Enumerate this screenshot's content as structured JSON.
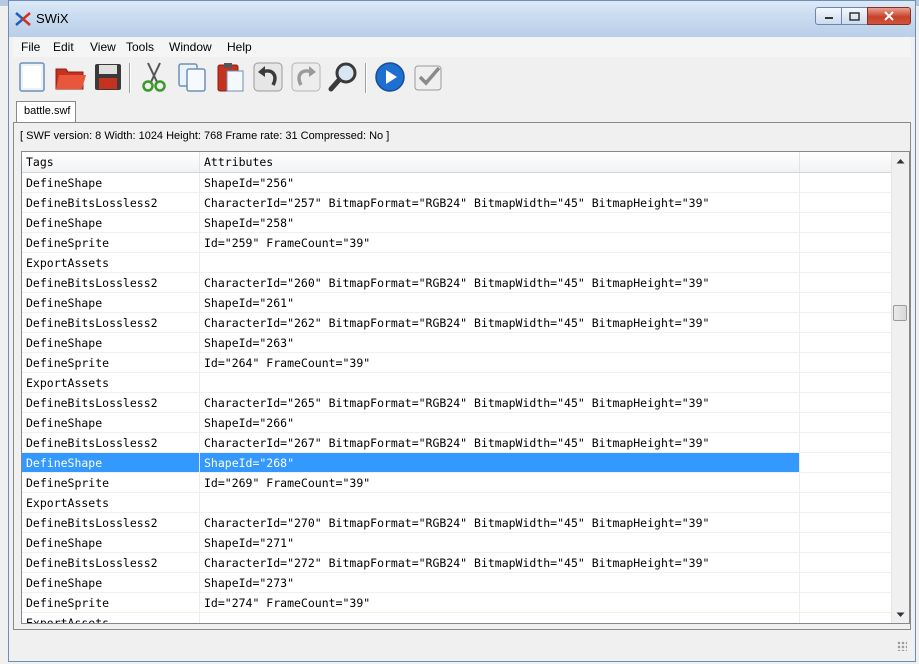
{
  "window": {
    "title": "SWiX"
  },
  "menu": {
    "items": [
      "File",
      "Edit",
      "View",
      "Tools",
      "Window",
      "Help"
    ]
  },
  "toolbar": {
    "buttons": [
      {
        "icon": "new-document-icon"
      },
      {
        "icon": "open-folder-icon"
      },
      {
        "icon": "save-disk-icon"
      },
      {
        "icon": "cut-scissors-icon"
      },
      {
        "icon": "copy-icon"
      },
      {
        "icon": "paste-clipboard-icon"
      },
      {
        "icon": "undo-arrow-icon"
      },
      {
        "icon": "redo-arrow-icon"
      },
      {
        "icon": "find-magnifier-icon"
      },
      {
        "icon": "run-play-icon"
      },
      {
        "icon": "validate-check-icon"
      }
    ]
  },
  "tabs": [
    {
      "label": "battle.swf"
    }
  ],
  "info": {
    "text": "[ SWF version: 8  Width: 1024  Height: 768  Frame rate: 31  Compressed: No ]"
  },
  "table": {
    "columns": [
      "Tags",
      "Attributes"
    ],
    "selected_index": 14,
    "rows": [
      {
        "tag": "DefineShape",
        "attributes": "ShapeId=\"256\""
      },
      {
        "tag": "DefineBitsLossless2",
        "attributes": "CharacterId=\"257\" BitmapFormat=\"RGB24\" BitmapWidth=\"45\" BitmapHeight=\"39\""
      },
      {
        "tag": "DefineShape",
        "attributes": "ShapeId=\"258\""
      },
      {
        "tag": "DefineSprite",
        "attributes": "Id=\"259\" FrameCount=\"39\""
      },
      {
        "tag": "ExportAssets",
        "attributes": ""
      },
      {
        "tag": "DefineBitsLossless2",
        "attributes": "CharacterId=\"260\" BitmapFormat=\"RGB24\" BitmapWidth=\"45\" BitmapHeight=\"39\""
      },
      {
        "tag": "DefineShape",
        "attributes": "ShapeId=\"261\""
      },
      {
        "tag": "DefineBitsLossless2",
        "attributes": "CharacterId=\"262\" BitmapFormat=\"RGB24\" BitmapWidth=\"45\" BitmapHeight=\"39\""
      },
      {
        "tag": "DefineShape",
        "attributes": "ShapeId=\"263\""
      },
      {
        "tag": "DefineSprite",
        "attributes": "Id=\"264\" FrameCount=\"39\""
      },
      {
        "tag": "ExportAssets",
        "attributes": ""
      },
      {
        "tag": "DefineBitsLossless2",
        "attributes": "CharacterId=\"265\" BitmapFormat=\"RGB24\" BitmapWidth=\"45\" BitmapHeight=\"39\""
      },
      {
        "tag": "DefineShape",
        "attributes": "ShapeId=\"266\""
      },
      {
        "tag": "DefineBitsLossless2",
        "attributes": "CharacterId=\"267\" BitmapFormat=\"RGB24\" BitmapWidth=\"45\" BitmapHeight=\"39\""
      },
      {
        "tag": "DefineShape",
        "attributes": "ShapeId=\"268\""
      },
      {
        "tag": "DefineSprite",
        "attributes": "Id=\"269\" FrameCount=\"39\""
      },
      {
        "tag": "ExportAssets",
        "attributes": ""
      },
      {
        "tag": "DefineBitsLossless2",
        "attributes": "CharacterId=\"270\" BitmapFormat=\"RGB24\" BitmapWidth=\"45\" BitmapHeight=\"39\""
      },
      {
        "tag": "DefineShape",
        "attributes": "ShapeId=\"271\""
      },
      {
        "tag": "DefineBitsLossless2",
        "attributes": "CharacterId=\"272\" BitmapFormat=\"RGB24\" BitmapWidth=\"45\" BitmapHeight=\"39\""
      },
      {
        "tag": "DefineShape",
        "attributes": "ShapeId=\"273\""
      },
      {
        "tag": "DefineSprite",
        "attributes": "Id=\"274\" FrameCount=\"39\""
      },
      {
        "tag": "ExportAssets",
        "attributes": ""
      }
    ]
  },
  "colors": {
    "selection": "#3399ff",
    "title_bar": "#c5d8ee",
    "close_button": "#c7422a"
  }
}
